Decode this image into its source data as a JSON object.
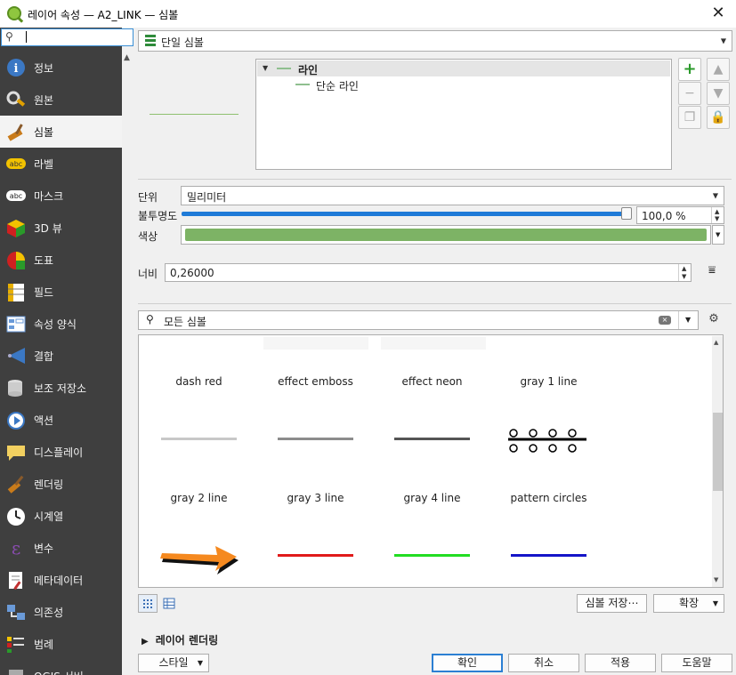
{
  "window": {
    "title": "레이어 속성 — A2_LINK — 심볼",
    "close_label": "✕"
  },
  "sidebar": {
    "search_icon": "search-icon",
    "search_value": "",
    "items": [
      {
        "label": "정보",
        "icon": "info-icon"
      },
      {
        "label": "원본",
        "icon": "source-icon"
      },
      {
        "label": "심볼",
        "icon": "symbology-icon",
        "active": true
      },
      {
        "label": "라벨",
        "icon": "labels-icon"
      },
      {
        "label": "마스크",
        "icon": "mask-icon"
      },
      {
        "label": "3D 뷰",
        "icon": "3d-view-icon"
      },
      {
        "label": "도표",
        "icon": "diagram-icon"
      },
      {
        "label": "필드",
        "icon": "fields-icon"
      },
      {
        "label": "속성 양식",
        "icon": "attributes-form-icon"
      },
      {
        "label": "결합",
        "icon": "joins-icon"
      },
      {
        "label": "보조 저장소",
        "icon": "auxiliary-storage-icon"
      },
      {
        "label": "액션",
        "icon": "actions-icon"
      },
      {
        "label": "디스플레이",
        "icon": "display-icon"
      },
      {
        "label": "렌더링",
        "icon": "rendering-icon"
      },
      {
        "label": "시계열",
        "icon": "temporal-icon"
      },
      {
        "label": "변수",
        "icon": "variables-icon"
      },
      {
        "label": "메타데이터",
        "icon": "metadata-icon"
      },
      {
        "label": "의존성",
        "icon": "dependencies-icon"
      },
      {
        "label": "범례",
        "icon": "legend-icon"
      },
      {
        "label": "QGIS 서버",
        "icon": "qgis-server-icon"
      }
    ]
  },
  "renderer": {
    "selected": "단일 심볼"
  },
  "symbol_tree": {
    "root": "라인",
    "child": "단순 라인"
  },
  "properties": {
    "unit_label": "단위",
    "unit_value": "밀리미터",
    "opacity_label": "불투명도",
    "opacity_value": "100,0 %",
    "opacity_fraction": 1.0,
    "color_label": "색상",
    "color_value": "#7db365",
    "width_label": "너비",
    "width_value": "0,26000"
  },
  "library": {
    "search_placeholder": "모든 심볼",
    "symbols": [
      {
        "name": "dash red",
        "color": "#c8c8c8",
        "style": "line"
      },
      {
        "name": "effect emboss",
        "color": "#8c8c8c",
        "style": "line"
      },
      {
        "name": "effect neon",
        "color": "#555555",
        "style": "line"
      },
      {
        "name": "gray 1 line",
        "color": "#000000",
        "style": "circles"
      },
      {
        "name": "gray 2 line",
        "color": "#f5891f",
        "style": "arrow"
      },
      {
        "name": "gray 3 line",
        "color": "#e01b1b",
        "style": "line"
      },
      {
        "name": "gray 4 line",
        "color": "#22dd22",
        "style": "line"
      },
      {
        "name": "pattern circles",
        "color": "#1515c8",
        "style": "line"
      }
    ]
  },
  "buttons": {
    "save_symbol": "심볼 저장⋯",
    "advanced": "확장",
    "style": "스타일",
    "ok": "확인",
    "cancel": "취소",
    "apply": "적용",
    "help": "도움말"
  },
  "layer_rendering": {
    "label": "레이어 렌더링"
  }
}
